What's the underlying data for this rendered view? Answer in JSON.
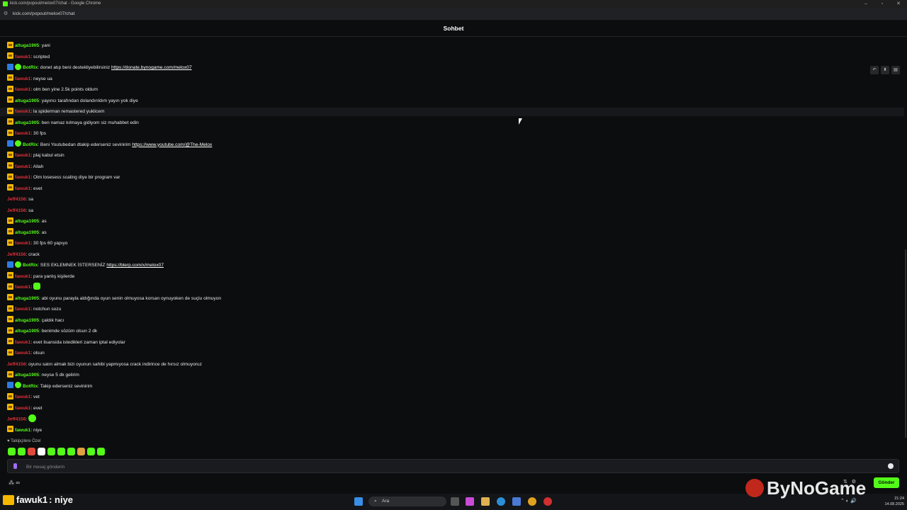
{
  "window": {
    "title": "kick.com/popout/melox07/chat - Google Chrome",
    "url": "kick.com/popout/melox07/chat"
  },
  "chat": {
    "title": "Sohbet",
    "messages": [
      {
        "badges": [
          "crown"
        ],
        "user": "altuga1905",
        "user_color": "#53fc18",
        "text": "yani"
      },
      {
        "badges": [
          "crown"
        ],
        "user": "fawuk1",
        "user_color": "#e0303a",
        "text": "scripted"
      },
      {
        "badges": [
          "bot",
          "verified"
        ],
        "user": "BotRix",
        "user_color": "#53fc18",
        "text": "donet atıp beni destekliyebilirsiniz ",
        "link": "https://donate.bynogame.com/melox07"
      },
      {
        "badges": [
          "crown"
        ],
        "user": "fawuk1",
        "user_color": "#e0303a",
        "text": "neyse ua"
      },
      {
        "badges": [
          "crown"
        ],
        "user": "fawuk1",
        "user_color": "#e0303a",
        "text": "olm ben yine 2.5k points oldum"
      },
      {
        "badges": [
          "crown"
        ],
        "user": "altuga1905",
        "user_color": "#53fc18",
        "text": "yayıncı tarafından dolandırıldım yayın yok diye"
      },
      {
        "badges": [
          "crown"
        ],
        "user": "fawuk1",
        "user_color": "#e0303a",
        "text": "la spiderman remastered yuklicem",
        "highlighted": true
      },
      {
        "badges": [
          "crown"
        ],
        "user": "altuga1905",
        "user_color": "#53fc18",
        "text": "ben namaz kılmaya gidiyom siz muhabbet edin"
      },
      {
        "badges": [
          "crown"
        ],
        "user": "fawuk1",
        "user_color": "#e0303a",
        "text": "30 fps"
      },
      {
        "badges": [
          "bot",
          "verified"
        ],
        "user": "BotRix",
        "user_color": "#53fc18",
        "text": "Beni Youtubedan dtakip ederseniz sevinirim ",
        "link": "https://www.youtube.com/@The-Melox"
      },
      {
        "badges": [
          "crown"
        ],
        "user": "fawuk1",
        "user_color": "#e0303a",
        "text": "plaj kabul etsin"
      },
      {
        "badges": [
          "crown"
        ],
        "user": "fawuk1",
        "user_color": "#e0303a",
        "text": "Allah"
      },
      {
        "badges": [
          "crown"
        ],
        "user": "fawuk1",
        "user_color": "#e0303a",
        "text": "Olm losesess scaling diye bir program var"
      },
      {
        "badges": [
          "crown"
        ],
        "user": "fawuk1",
        "user_color": "#e0303a",
        "text": "evet"
      },
      {
        "badges": [],
        "user": "Jeff4156",
        "user_color": "#e0303a",
        "text": "sa"
      },
      {
        "badges": [],
        "user": "Jeff4156",
        "user_color": "#e0303a",
        "text": "sa"
      },
      {
        "badges": [
          "crown"
        ],
        "user": "altuga1905",
        "user_color": "#53fc18",
        "text": "as"
      },
      {
        "badges": [
          "crown"
        ],
        "user": "altuga1905",
        "user_color": "#53fc18",
        "text": "as"
      },
      {
        "badges": [
          "crown"
        ],
        "user": "fawuk1",
        "user_color": "#e0303a",
        "text": "30 fps 60 yapıyo"
      },
      {
        "badges": [],
        "user": "Jeff4156",
        "user_color": "#e0303a",
        "text": "crack"
      },
      {
        "badges": [
          "bot",
          "verified"
        ],
        "user": "BotRix",
        "user_color": "#53fc18",
        "text": "SES EKLEMNEK İSTERSENİZ ",
        "link": "https://blerp.com/x/melox07"
      },
      {
        "badges": [
          "crown"
        ],
        "user": "fawuk1",
        "user_color": "#e0303a",
        "text": "para yanlış kişilerde"
      },
      {
        "badges": [
          "crown"
        ],
        "user": "fawuk1",
        "user_color": "#e0303a",
        "text": "",
        "emote": "square"
      },
      {
        "badges": [
          "crown"
        ],
        "user": "altuga1905",
        "user_color": "#53fc18",
        "text": "abi oyunu parayla aldığında oyun senin olmuyosa korsan oynuyoken de suçlu olmuyon"
      },
      {
        "badges": [
          "crown"
        ],
        "user": "fawuk1",
        "user_color": "#e0303a",
        "text": "notchun sozu"
      },
      {
        "badges": [
          "crown"
        ],
        "user": "altuga1905",
        "user_color": "#53fc18",
        "text": "çaldık hacı"
      },
      {
        "badges": [
          "crown"
        ],
        "user": "altuga1905",
        "user_color": "#53fc18",
        "text": "benimde sözüm olsun 2 dk"
      },
      {
        "badges": [
          "crown"
        ],
        "user": "fawuk1",
        "user_color": "#e0303a",
        "text": "evet lisansida istedikleri zaman iptal ediyolar"
      },
      {
        "badges": [
          "crown"
        ],
        "user": "fawuk1",
        "user_color": "#e0303a",
        "text": "olsun"
      },
      {
        "badges": [],
        "user": "Jeff4156",
        "user_color": "#e0303a",
        "text": "oyunu satın almak bizi oyunun sahibi yapmıyosa crack indirince de hırsız olmuyoruz"
      },
      {
        "badges": [
          "crown"
        ],
        "user": "altuga1905",
        "user_color": "#53fc18",
        "text": "neyse 5 dk gelirim"
      },
      {
        "badges": [
          "bot",
          "verified"
        ],
        "user": "BotRix",
        "user_color": "#53fc18",
        "text": "Takip ederseniz sevinirim"
      },
      {
        "badges": [
          "crown"
        ],
        "user": "fawuk1",
        "user_color": "#e0303a",
        "text": "vet"
      },
      {
        "badges": [
          "crown"
        ],
        "user": "fawuk1",
        "user_color": "#e0303a",
        "text": "evet"
      },
      {
        "badges": [],
        "user": "Jeff4156",
        "user_color": "#e0303a",
        "text": "",
        "emote": "round"
      },
      {
        "badges": [
          "crown"
        ],
        "user": "fawuk1",
        "user_color": "#53fc18",
        "text": "niye"
      }
    ],
    "followers_label": "♥ Takipçilere Özel",
    "tray_emote_colors": [
      "#53fc18",
      "#53fc18",
      "#e04a3a",
      "#ffffff",
      "#53fc18",
      "#53fc18",
      "#53fc18",
      "#e0a040",
      "#53fc18",
      "#53fc18"
    ],
    "input_placeholder": "Bir mesaj gönderin",
    "send_label": "Gönder",
    "bottom_left": "∞"
  },
  "overlay": {
    "user": "fawuk1",
    "text": ": niye",
    "watermark": "ByNoGame"
  },
  "taskbar": {
    "search_label": "Ara",
    "time": "21:24",
    "date": "14.08.2025"
  },
  "colors": {
    "accent": "#53fc18",
    "bg": "#0c0d0e"
  }
}
